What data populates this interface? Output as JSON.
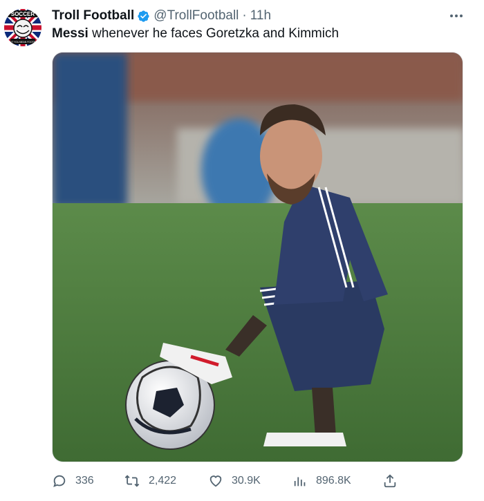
{
  "author": {
    "name": "Troll Football",
    "handle": "@TrollFootball",
    "separator": "·",
    "time": "11h",
    "avatar_text_top": "SOCCER",
    "avatar_text_bottom": "DON'T YOU MEAN FOOTBALL"
  },
  "tweet": {
    "bold_text": "Messi",
    "text": " whenever he faces Goretzka and Kimmich"
  },
  "media": {
    "description_icon": "photo-image"
  },
  "actions": {
    "replies": "336",
    "reposts": "2,422",
    "likes": "30.9K",
    "views": "896.8K"
  },
  "colors": {
    "verified": "#1d9bf0",
    "text_primary": "#0f1419",
    "text_secondary": "#536471",
    "grass": "#4d7a3e",
    "jersey": "#2f3f6c"
  }
}
